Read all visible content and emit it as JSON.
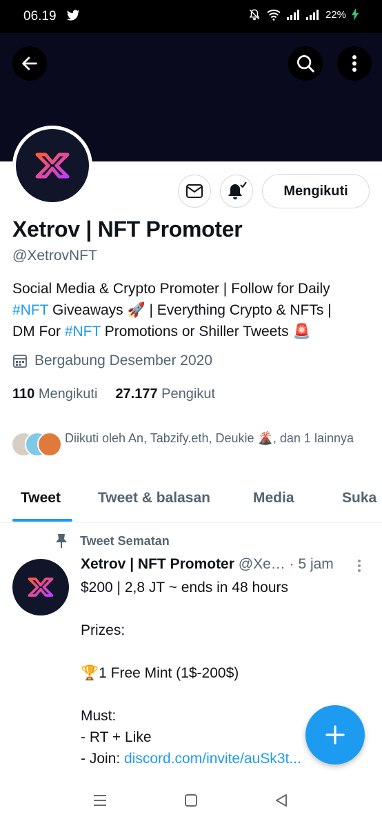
{
  "status_bar": {
    "time": "06.19",
    "battery": "22%"
  },
  "profile": {
    "name": "Xetrov | NFT Promoter",
    "handle": "@XetrovNFT",
    "follow_button": "Mengikuti",
    "bio_line1": "Social Media & Crypto Promoter | Follow for Daily",
    "bio_tag1": "#NFT",
    "bio_line2": " Giveaways 🚀 | Everything Crypto & NFTs |",
    "bio_line3a": "DM For ",
    "bio_tag2": "#NFT",
    "bio_line3b": " Promotions or Shiller Tweets 🚨",
    "joined": "Bergabung Desember 2020",
    "following_count": "110",
    "following_label": "Mengikuti",
    "followers_count": "27.177",
    "followers_label": "Pengikut",
    "followed_by": "Diikuti oleh An, Tabzify.eth, Deukie 🌋, dan 1 lainnya"
  },
  "tabs": [
    "Tweet",
    "Tweet & balasan",
    "Media",
    "Suka"
  ],
  "pinned_tweet": {
    "label": "Tweet Sematan",
    "author_name": "Xetrov | NFT Promoter",
    "author_handle": "@Xe…",
    "time": "· 5 jam",
    "body": "$200 | 2,8 JT ~ ends in 48 hours\n\nPrizes:\n\n🏆1 Free Mint (1$-200$)\n\nMust:\n- RT + Like",
    "join_prefix": "- Join: ",
    "join_link": "discord.com/invite/auSk3t..."
  },
  "colors": {
    "accent": "#1d9bf0",
    "banner": "#0a0a1e",
    "text_secondary": "#536471"
  }
}
